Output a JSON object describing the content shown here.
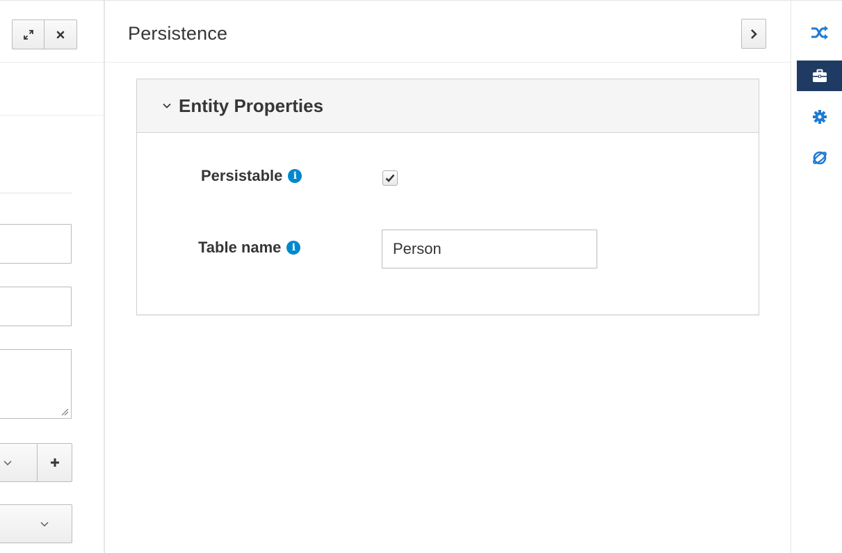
{
  "panel": {
    "title": "Persistence"
  },
  "card": {
    "title": "Entity Properties"
  },
  "form": {
    "persistable": {
      "label": "Persistable",
      "checked": true
    },
    "table_name": {
      "label": "Table name",
      "value": "Person"
    }
  },
  "rail": {
    "items": [
      {
        "icon": "shuffle-icon",
        "active": false
      },
      {
        "icon": "briefcase-icon",
        "active": true
      },
      {
        "icon": "gear-icon",
        "active": false
      },
      {
        "icon": "planet-icon",
        "active": false
      }
    ]
  },
  "colors": {
    "accent_blue": "#0088ce",
    "rail_active": "#1f3b63"
  }
}
